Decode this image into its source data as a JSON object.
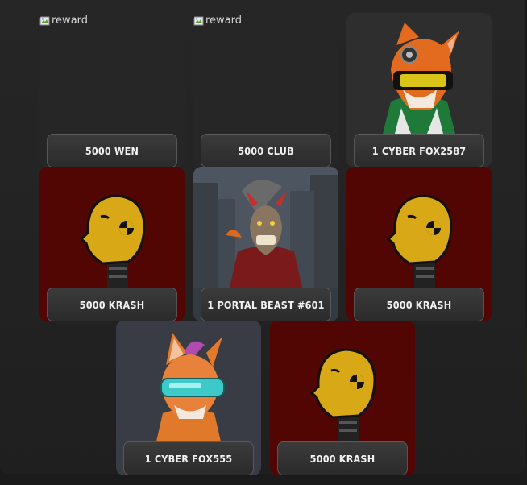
{
  "rewards": [
    {
      "label": "5000 WEN",
      "image": "broken",
      "alt": "reward",
      "art": "none",
      "bg": "dark"
    },
    {
      "label": "5000 CLUB",
      "image": "broken",
      "alt": "reward",
      "art": "none",
      "bg": "dark"
    },
    {
      "label": "1 CYBER FOX2587",
      "image": "cyber-fox-goggles",
      "bg": "gray"
    },
    {
      "label": "5000 KRASH",
      "image": "crash-dummy-head",
      "bg": "red"
    },
    {
      "label": "1 PORTAL BEAST #601",
      "image": "portal-beast-city",
      "bg": "scene"
    },
    {
      "label": "5000 KRASH",
      "image": "crash-dummy-head",
      "bg": "red"
    },
    {
      "label": "1 CYBER FOX555",
      "image": "cyber-fox-visor",
      "bg": "slate"
    },
    {
      "label": "5000 KRASH",
      "image": "crash-dummy-head",
      "bg": "red"
    }
  ],
  "colors": {
    "card_red": "#520604",
    "card_slate": "#393c45",
    "label_border": "#5b5b5b",
    "page_bg": "#1b1b1b"
  }
}
